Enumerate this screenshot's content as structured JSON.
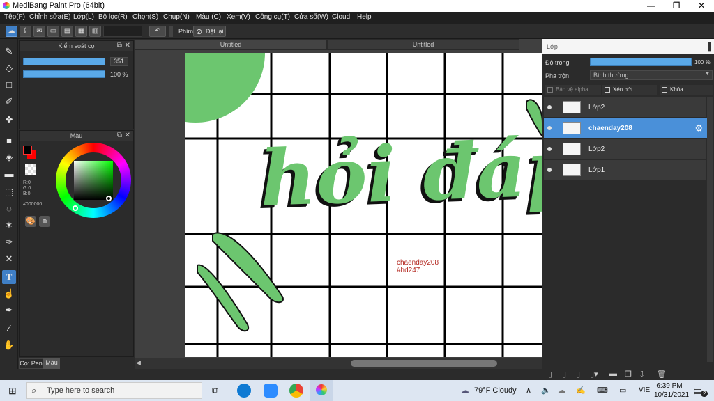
{
  "window": {
    "title": "MediBang Paint Pro (64bit)",
    "minimize_icon": "—",
    "maximize_icon": "❐",
    "close_icon": "✕"
  },
  "menu": [
    "Tệp(F)",
    "Chỉnh sửa(E)",
    "Lớp(L)",
    "Bộ lọc(R)",
    "Chọn(S)",
    "Chụp(N)",
    "Màu (C)",
    "Xem(V)",
    "Công cụ(T)",
    "Cửa sổ(W)",
    "Cloud",
    "Help"
  ],
  "toolbar": {
    "shortcut_label": "Phím",
    "reset_label": "Đặt lại"
  },
  "brush_panel": {
    "title": "Kiểm soát cọ",
    "size_value": "351",
    "opacity_value": "100 %",
    "opacity_level": 1.0
  },
  "color_panel": {
    "title": "Màu",
    "r_label": "R:0",
    "g_label": "G:0",
    "b_label": "B:0",
    "hex": "#000000",
    "fg_color": "#000000",
    "bg_color": "#ff0000"
  },
  "bottom_tabs": {
    "pen_tab": "Cọ: Pen",
    "color_tab": "Màu"
  },
  "canvas": {
    "tabs": [
      "Untitled",
      "Untitled"
    ],
    "signature_line1": "chaenday208",
    "signature_line2": "#hd247",
    "lettering": "hỏi đáp",
    "accent_green": "#6cc66f"
  },
  "layers_panel": {
    "title": "Lớp",
    "opacity_label": "Độ trong",
    "opacity_value": "100 %",
    "blend_label": "Pha trộn",
    "blend_value": "Bình thường",
    "protect_alpha": "Bảo vệ alpha",
    "clipping": "Xén bớt",
    "lock": "Khóa",
    "layers": [
      {
        "name": "Lớp2",
        "selected": false
      },
      {
        "name": "chaenday208",
        "selected": true
      },
      {
        "name": "Lớp2",
        "selected": false
      },
      {
        "name": "Lớp1",
        "selected": false
      }
    ]
  },
  "taskbar": {
    "search_placeholder": "Type here to search",
    "weather": "79°F  Cloudy",
    "lang": "VIE",
    "time": "6:39 PM",
    "date": "10/31/2021",
    "notification_count": "2"
  }
}
